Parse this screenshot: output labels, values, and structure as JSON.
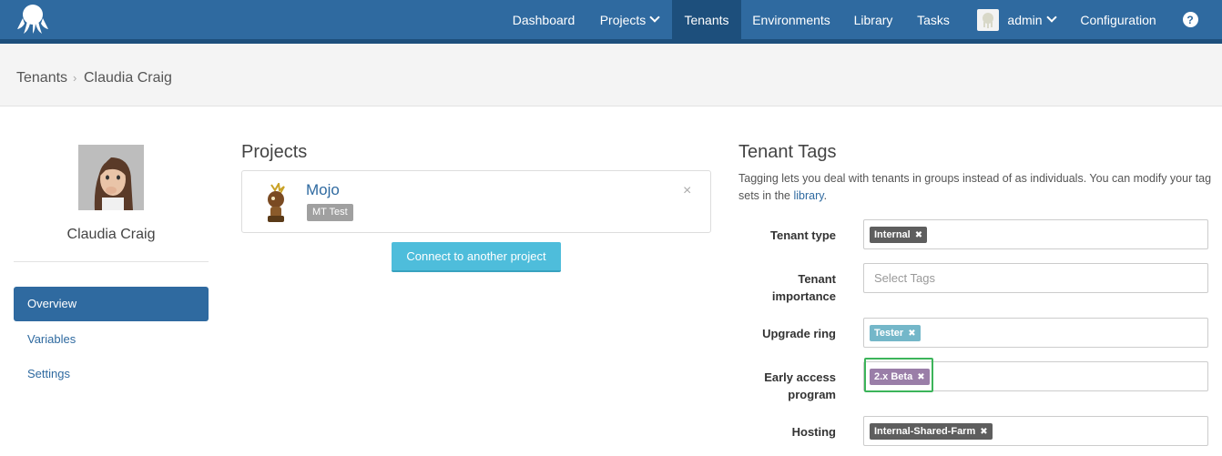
{
  "nav": {
    "items": [
      "Dashboard",
      "Projects",
      "Tenants",
      "Environments",
      "Library",
      "Tasks"
    ],
    "user": "admin",
    "configuration": "Configuration",
    "help": "?"
  },
  "breadcrumb": {
    "parent": "Tenants",
    "separator": "›",
    "current": "Claudia Craig"
  },
  "tenant": {
    "name": "Claudia Craig"
  },
  "sidebar": {
    "items": [
      {
        "label": "Overview",
        "active": true
      },
      {
        "label": "Variables",
        "active": false
      },
      {
        "label": "Settings",
        "active": false
      }
    ]
  },
  "projects": {
    "heading": "Projects",
    "items": [
      {
        "name": "Mojo",
        "environment_tag": "MT Test"
      }
    ],
    "remove_glyph": "×",
    "connect_label": "Connect to another project"
  },
  "tags": {
    "heading": "Tenant Tags",
    "description_before": "Tagging lets you deal with tenants in groups instead of as individuals. You can modify your tag sets in the ",
    "description_link": "library",
    "description_after": ".",
    "fields": [
      {
        "label": "Tenant type",
        "chip": "Internal",
        "chip_color": "#5e5e5e"
      },
      {
        "label": "Tenant importance",
        "placeholder": "Select Tags"
      },
      {
        "label": "Upgrade ring",
        "chip": "Tester",
        "chip_color": "#74b7c9"
      },
      {
        "label": "Early access program",
        "chip": "2.x Beta",
        "chip_color": "#9a7ea8"
      },
      {
        "label": "Hosting",
        "chip": "Internal-Shared-Farm",
        "chip_color": "#5e5e5e"
      }
    ],
    "remove_glyph": "✖"
  },
  "colors": {
    "brand": "#2f6aa0",
    "brand_dark": "#1d4f7c",
    "button": "#4ebddb",
    "highlight": "#3cb45a"
  }
}
